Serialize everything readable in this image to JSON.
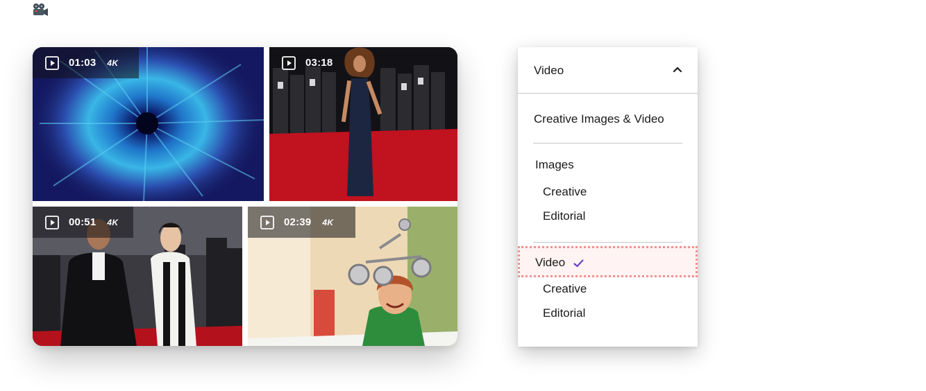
{
  "header_icon": "video-camera-icon",
  "gallery": {
    "tiles": [
      {
        "duration": "01:03",
        "resolution": "4K",
        "subject": "blue color burst"
      },
      {
        "duration": "03:18",
        "resolution": "",
        "subject": "woman on red carpet"
      },
      {
        "duration": "00:51",
        "resolution": "4K",
        "subject": "couple on red carpet"
      },
      {
        "duration": "02:39",
        "resolution": "4K",
        "subject": "boy with toy rover"
      }
    ]
  },
  "dropdown": {
    "selected_label": "Video",
    "items": {
      "creative_images_video": "Creative Images & Video",
      "images": "Images",
      "images_creative": "Creative",
      "images_editorial": "Editorial",
      "video": "Video",
      "video_creative": "Creative",
      "video_editorial": "Editorial"
    },
    "colors": {
      "check": "#6b3fc8",
      "highlight_border": "#f29191"
    }
  }
}
